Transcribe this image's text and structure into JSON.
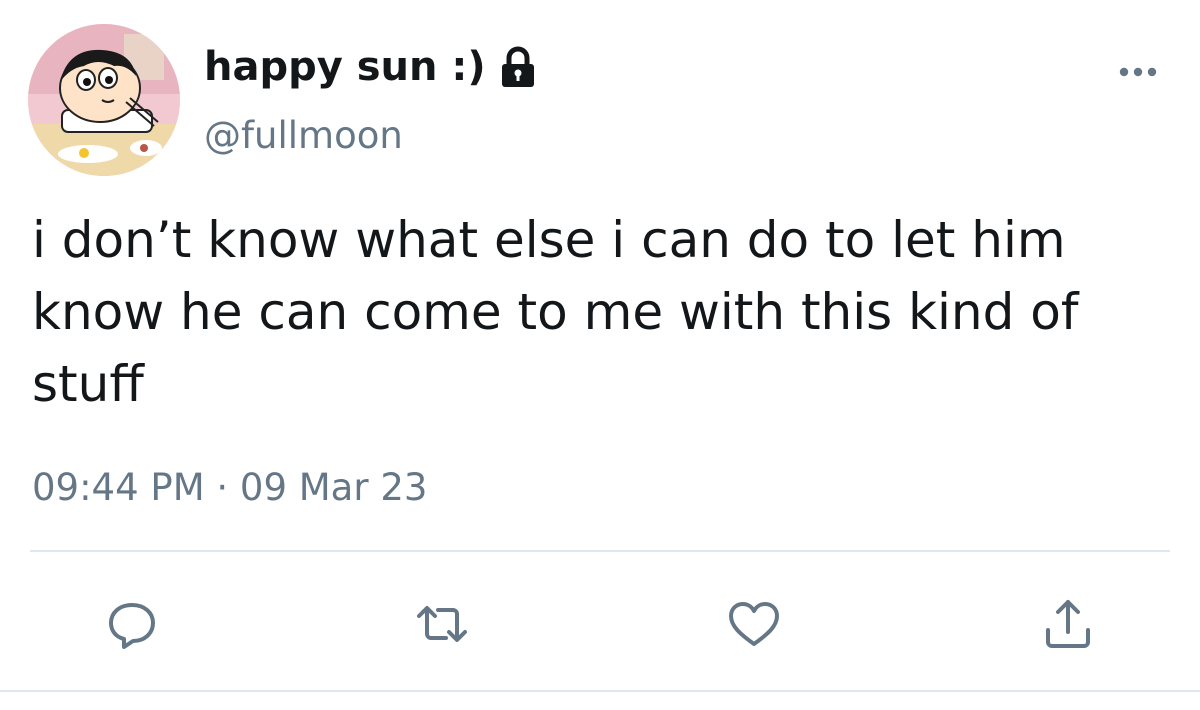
{
  "tweet": {
    "display_name": "happy sun :)",
    "handle": "@fullmoon",
    "protected": true,
    "text": "i don’t know what else i can do to let him know he can come to me with this kind of stuff",
    "timestamp": "09:44 PM · 09 Mar 23"
  },
  "icons": {
    "lock": "lock-icon",
    "more": "more-icon",
    "reply": "reply-icon",
    "retweet": "retweet-icon",
    "like": "heart-icon",
    "share": "share-icon"
  },
  "colors": {
    "text": "#14171a",
    "secondary": "#657786",
    "icon": "#657786",
    "divider": "#e1e8ed"
  }
}
